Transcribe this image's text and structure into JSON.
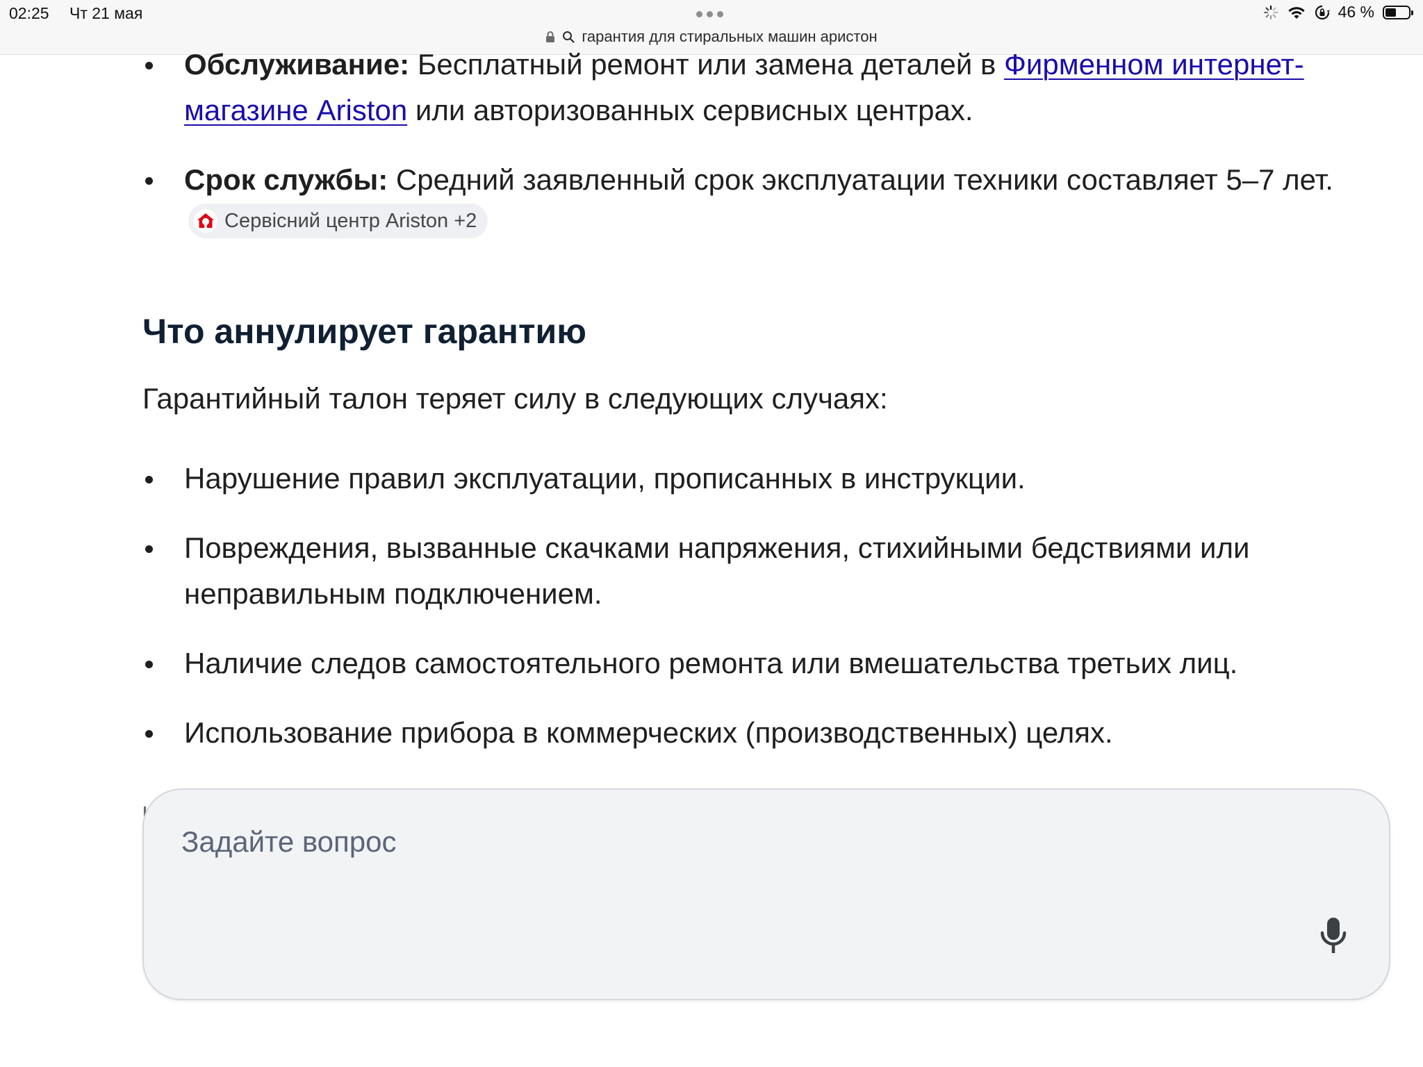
{
  "status_bar": {
    "time": "02:25",
    "date": "Чт 21 мая",
    "battery_text": "46 %",
    "battery_level": 0.46
  },
  "url_bar": {
    "query": "гарантия для стиральных машин аристон"
  },
  "top_list": {
    "service": {
      "label": "Обслуживание:",
      "text_before": " Бесплатный ремонт или замена деталей в ",
      "link_text": "Фирменном интернет-магазине Ariston",
      "text_after": " или авторизованных сервисных центрах."
    },
    "lifetime": {
      "label": "Срок службы:",
      "text": " Средний заявленный срок эксплуатации техники составляет 5–7 лет.",
      "chip_label": "Сервісний центр Ariston +2"
    }
  },
  "section": {
    "title": "Что аннулирует гарантию",
    "intro": "Гарантийный талон теряет силу в следующих случаях:",
    "items": [
      "Нарушение правил эксплуатации, прописанных в инструкции.",
      "Повреждения, вызванные скачками напряжения, стихийными бедствиями или неправильным подключением.",
      "Наличие следов самостоятельного ремонта или вмешательства третьих лиц.",
      "Использование прибора в коммерческих (производственных) целях."
    ]
  },
  "ask_box": {
    "placeholder": "Задайте вопрос"
  },
  "colors": {
    "link": "#1a0dab",
    "heading": "#102033",
    "ariston_red": "#e30613",
    "ask_box_bg": "#f1f3f5"
  }
}
